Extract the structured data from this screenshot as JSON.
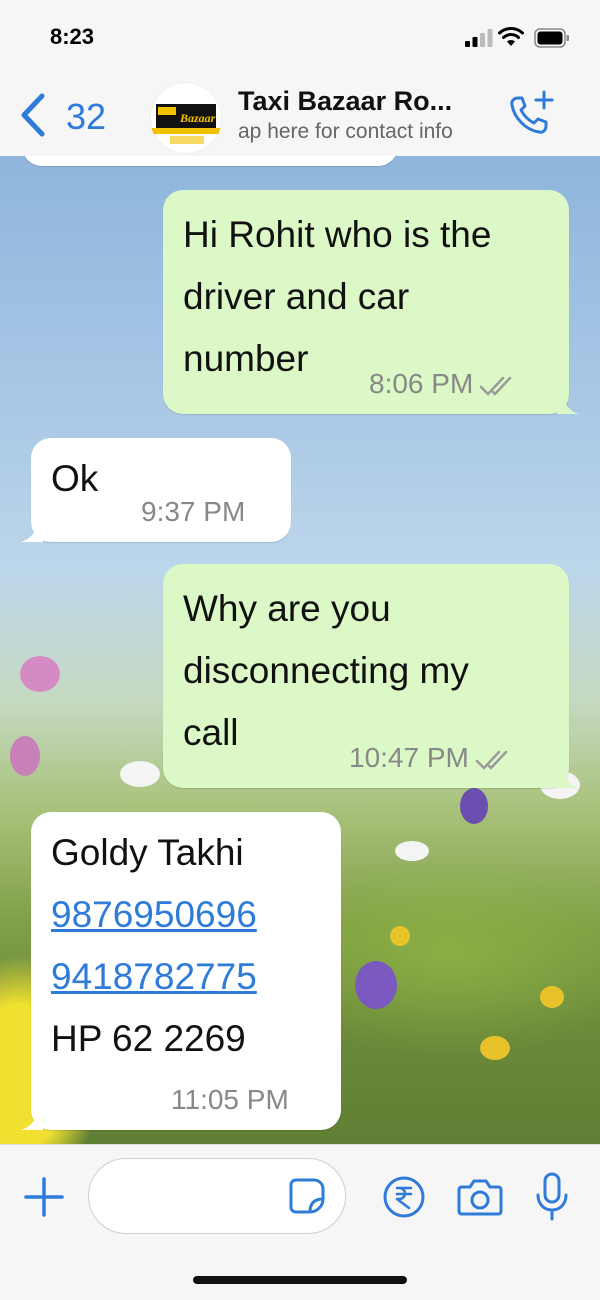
{
  "status_bar": {
    "time": "8:23"
  },
  "header": {
    "back_count": "32",
    "contact_name": "Taxi Bazaar Ro...",
    "contact_subtitle": "ap here for contact info",
    "avatar_logo_text": "Bazaar"
  },
  "messages": [
    {
      "direction": "outgoing",
      "lines": [
        "Hi Rohit who is the",
        "driver and car",
        "number"
      ],
      "time": "8:06 PM",
      "ticks": "read"
    },
    {
      "direction": "incoming",
      "lines": [
        "Ok"
      ],
      "time": "9:37 PM"
    },
    {
      "direction": "outgoing",
      "lines": [
        "Why are you",
        "disconnecting my",
        "call"
      ],
      "time": "10:47 PM",
      "ticks": "read"
    },
    {
      "direction": "incoming",
      "lines": [
        "Goldy Takhi",
        "9876950696",
        "9418782775",
        "HP 62 2269"
      ],
      "links": [
        "9876950696",
        "9418782775"
      ],
      "time": "11:05 PM"
    }
  ],
  "input": {
    "placeholder": ""
  },
  "colors": {
    "accent": "#2f7bd9",
    "outgoing_bubble": "#dcf8c6",
    "incoming_bubble": "#ffffff",
    "bar_background": "#f6f6f6"
  },
  "icons": [
    "back-chevron-icon",
    "video-call-add-icon",
    "plus-icon",
    "sticker-icon",
    "rupee-payment-icon",
    "camera-icon",
    "microphone-icon",
    "double-tick-icon"
  ]
}
